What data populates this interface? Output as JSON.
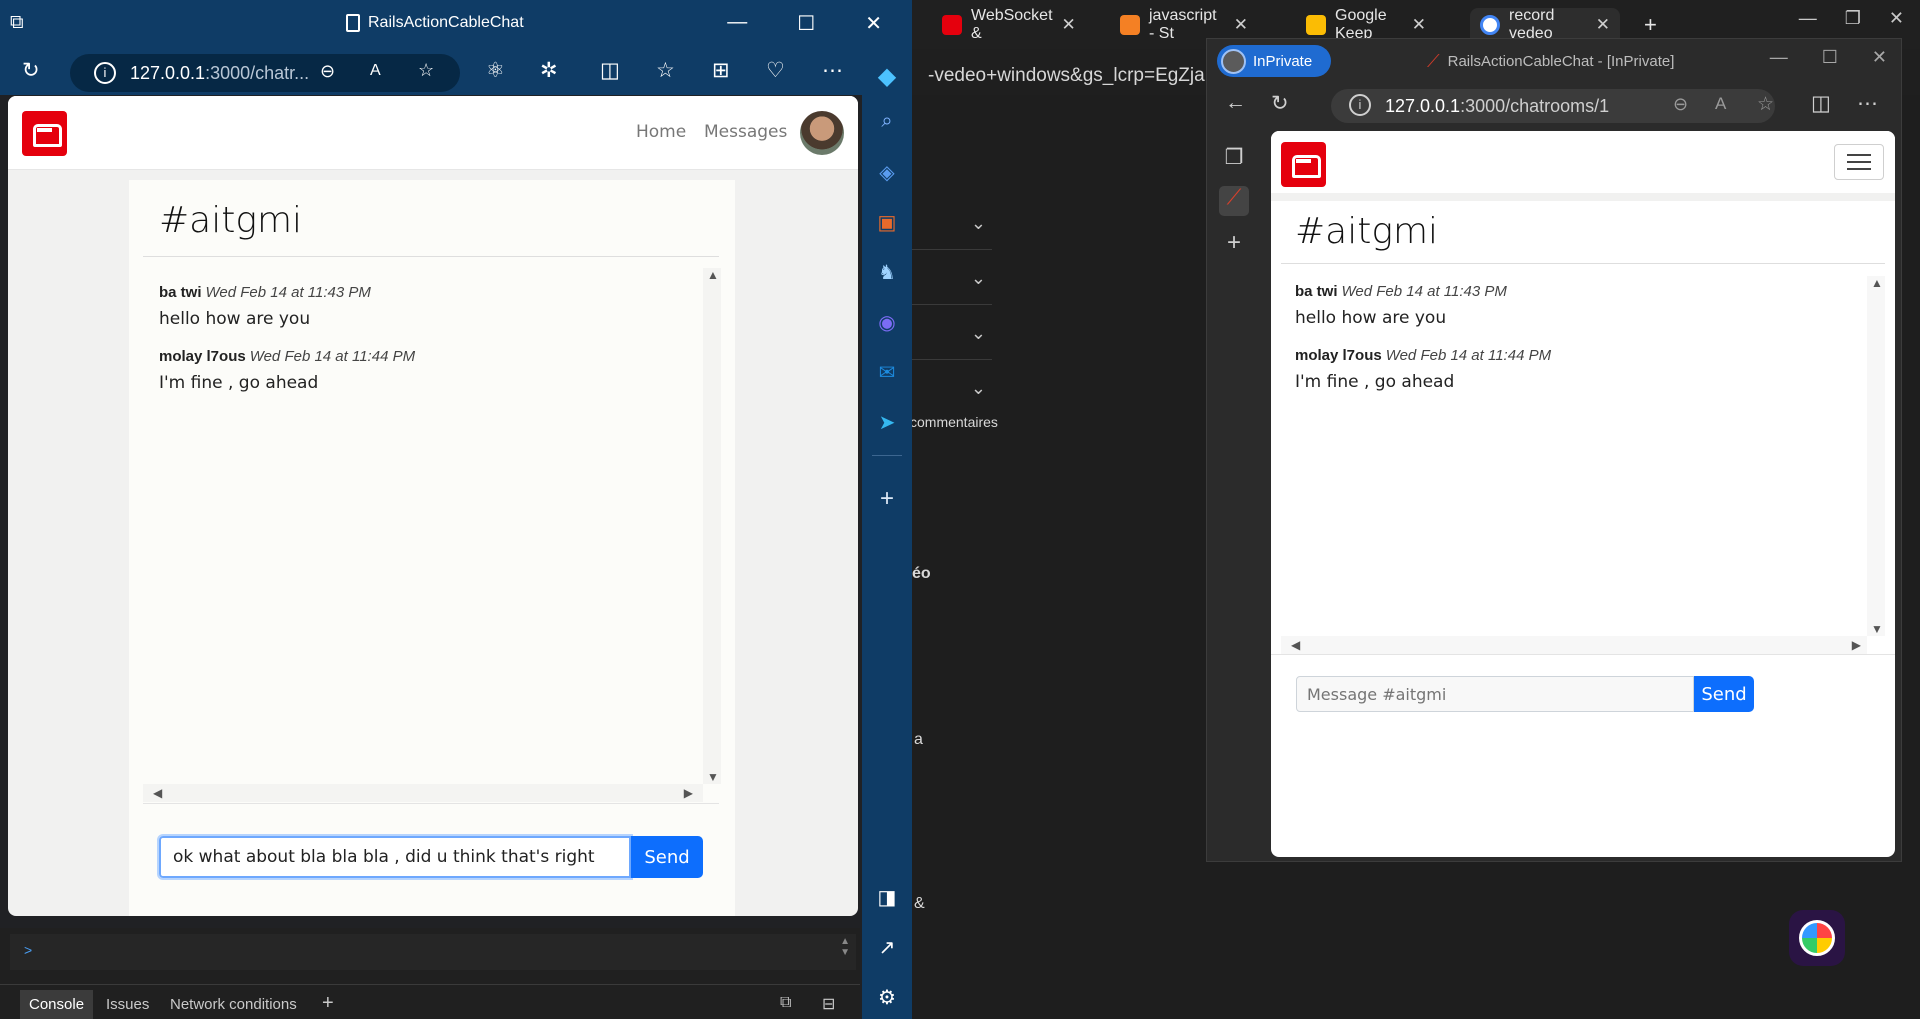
{
  "background_browser": {
    "tabs": [
      {
        "label": "WebSocket &",
        "favicon_color": "#e5000d"
      },
      {
        "label": "javascript - St",
        "favicon_color": "#f48024"
      },
      {
        "label": "Google Keep",
        "favicon_color": "#fbbc04"
      },
      {
        "label": "record vedeo",
        "favicon_color": "#4285f4"
      }
    ],
    "new_tab_icon": "plus-icon",
    "url_fragment": "-vedeo+windows&gs_lcrp=EgZjaHJvbW",
    "page_fragments": [
      "commentaires",
      "éo",
      "a",
      "&"
    ]
  },
  "inprivate_window": {
    "badge": "InPrivate",
    "title": "RailsActionCableChat - [InPrivate]",
    "url_host": "127.0.0.1",
    "url_path": ":3000/chatrooms/1",
    "app": {
      "room_title": "#aitgmi",
      "messages": [
        {
          "author": "ba twi",
          "time": "Wed Feb 14 at 11:43 PM",
          "body": "hello how are you"
        },
        {
          "author": "molay l7ous",
          "time": "Wed Feb 14 at 11:44 PM",
          "body": "I'm fine , go ahead"
        }
      ],
      "input_placeholder": "Message #aitgmi",
      "input_value": "",
      "send_label": "Send"
    }
  },
  "main_window": {
    "title": "RailsActionCableChat",
    "url_host": "127.0.0.1",
    "url_path": ":3000/chatr...",
    "app": {
      "nav": {
        "home": "Home",
        "messages": "Messages"
      },
      "room_title": "#aitgmi",
      "messages": [
        {
          "author": "ba twi",
          "time": "Wed Feb 14 at 11:43 PM",
          "body": "hello how are you"
        },
        {
          "author": "molay l7ous",
          "time": "Wed Feb 14 at 11:44 PM",
          "body": "I'm fine , go ahead"
        }
      ],
      "input_value": "ok what about bla bla bla , did u think that's right",
      "send_label": "Send"
    }
  },
  "devtools": {
    "tabs": [
      "Console",
      "Issues",
      "Network conditions"
    ],
    "prompt": ">"
  },
  "colors": {
    "brand_red": "#e5000d",
    "send_blue": "#0d6efd",
    "edge_frame": "#0f3c66"
  }
}
